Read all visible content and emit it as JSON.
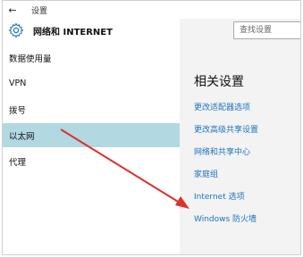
{
  "window": {
    "title": "设置",
    "back_icon": "back-arrow-icon"
  },
  "header": {
    "section_title": "网络和 INTERNET",
    "icon": "gear-icon"
  },
  "search": {
    "placeholder": "查找设置"
  },
  "sidebar": {
    "items": [
      {
        "label": "数据使用量",
        "active": false
      },
      {
        "label": "VPN",
        "active": false
      },
      {
        "label": "拨号",
        "active": false
      },
      {
        "label": "以太网",
        "active": true
      },
      {
        "label": "代理",
        "active": false
      }
    ]
  },
  "related": {
    "title": "相关设置",
    "links": [
      "更改适配器选项",
      "更改高级共享设置",
      "网络和共享中心",
      "家庭组",
      "Internet 选项",
      "Windows 防火墙"
    ]
  },
  "colors": {
    "accent": "#1e73be",
    "active_item_bg": "#b2d8e2",
    "annotation_arrow": "#e0302a"
  }
}
